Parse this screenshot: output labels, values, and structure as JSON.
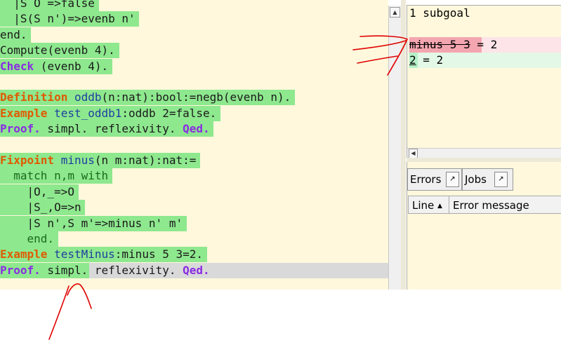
{
  "editor": {
    "lines": [
      {
        "parts": [
          {
            "t": "  |S O =>false",
            "c": "tx"
          }
        ]
      },
      {
        "parts": [
          {
            "t": "  |S(S n')=>evenb n'",
            "c": "tx"
          }
        ]
      },
      {
        "parts": [
          {
            "t": "end.",
            "c": "tx"
          }
        ]
      },
      {
        "parts": [
          {
            "t": "Compute",
            "c": "tx"
          },
          {
            "t": "(evenb 4).",
            "c": "tx"
          }
        ]
      },
      {
        "parts": [
          {
            "t": "Check",
            "c": "kw2"
          },
          {
            "t": " (evenb 4).",
            "c": "tx"
          }
        ]
      },
      {
        "parts": []
      },
      {
        "parts": [
          {
            "t": "Definition",
            "c": "kw"
          },
          {
            "t": " ",
            "c": "tx"
          },
          {
            "t": "oddb",
            "c": "id"
          },
          {
            "t": "(n:nat):bool:=negb(evenb n).",
            "c": "tx"
          }
        ]
      },
      {
        "parts": [
          {
            "t": "Example",
            "c": "kw"
          },
          {
            "t": " ",
            "c": "tx"
          },
          {
            "t": "test_oddb1",
            "c": "id"
          },
          {
            "t": ":oddb 2=false.",
            "c": "tx"
          }
        ]
      },
      {
        "parts": [
          {
            "t": "Proof.",
            "c": "kw2"
          },
          {
            "t": " simpl. reflexivity. ",
            "c": "tx"
          },
          {
            "t": "Qed.",
            "c": "kw2"
          }
        ]
      },
      {
        "parts": []
      },
      {
        "parts": [
          {
            "t": "Fixpoint",
            "c": "kw"
          },
          {
            "t": " ",
            "c": "tx"
          },
          {
            "t": "minus",
            "c": "id"
          },
          {
            "t": "(n m:nat):nat:=",
            "c": "tx"
          }
        ]
      },
      {
        "parts": [
          {
            "t": "  match n,m with",
            "c": "mt"
          }
        ]
      },
      {
        "parts": [
          {
            "t": "    |O,_=>O",
            "c": "tx"
          }
        ]
      },
      {
        "parts": [
          {
            "t": "    |S_,O=>n",
            "c": "tx"
          }
        ]
      },
      {
        "parts": [
          {
            "t": "    |S n',S m'=>minus n' m'",
            "c": "tx"
          }
        ]
      },
      {
        "parts": [
          {
            "t": "    end.",
            "c": "mt"
          }
        ]
      },
      {
        "parts": [
          {
            "t": "Example",
            "c": "kw"
          },
          {
            "t": " ",
            "c": "tx"
          },
          {
            "t": "testMinus",
            "c": "id"
          },
          {
            "t": ":minus 5 3=2.",
            "c": "tx"
          }
        ]
      },
      {
        "parts": [
          {
            "t": "Proof.",
            "c": "kw2"
          },
          {
            "t": " simpl.",
            "c": "tx"
          },
          {
            "t": " reflexivity. ",
            "c": "tx"
          },
          {
            "t": "Qed.",
            "c": "kw2"
          }
        ]
      }
    ],
    "cursor_line_text": "Proof. simpl."
  },
  "goals": {
    "header": "1 subgoal",
    "old_goal": "minus 5 3",
    "old_goal_rest": " = 2",
    "new_goal_lhs": "2",
    "new_goal_rest": " = 2"
  },
  "messages": {
    "errors_tab": "Errors",
    "jobs_tab": "Jobs",
    "detach_icon": "↗",
    "col_line": "Line",
    "col_sort_icon": "▲",
    "col_message": "Error message"
  },
  "colors": {
    "processed_bg": "#8ee88e",
    "editor_bg": "#fff8dc",
    "pending_bg": "#d9d9d9",
    "removed_bg": "#f4a6b0",
    "added_bg": "#b6f0c8",
    "annotation_red": "#e00000"
  }
}
